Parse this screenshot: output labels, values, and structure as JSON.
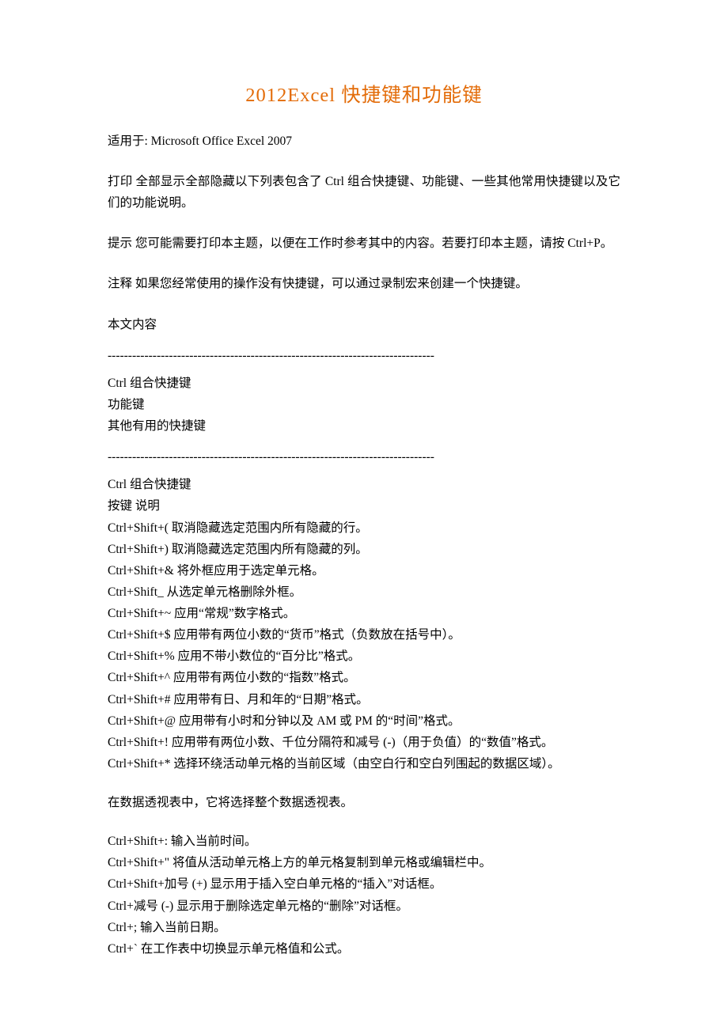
{
  "title": "2012Excel 快捷键和功能键",
  "applies_to": "适用于: Microsoft Office Excel 2007",
  "intro": "打印 全部显示全部隐藏以下列表包含了 Ctrl 组合快捷键、功能键、一些其他常用快捷键以及它们的功能说明。",
  "tip_label": "  提示",
  "tip_body": "    您可能需要打印本主题，以便在工作时参考其中的内容。若要打印本主题，请按 Ctrl+P。",
  "note_label": "  注释",
  "note_body": "    如果您经常使用的操作没有快捷键，可以通过录制宏来创建一个快捷键。",
  "toc_heading": "本文内容",
  "divider": "--------------------------------------------------------------------------------",
  "toc": {
    "item1": "Ctrl 组合快捷键",
    "item2": "功能键",
    "item3": "其他有用的快捷键"
  },
  "section1_heading": "Ctrl 组合快捷键",
  "section1_header_row": "按键 说明",
  "shortcuts1": {
    "l0": "Ctrl+Shift+( 取消隐藏选定范围内所有隐藏的行。",
    "l1": "Ctrl+Shift+) 取消隐藏选定范围内所有隐藏的列。",
    "l2": "Ctrl+Shift+& 将外框应用于选定单元格。",
    "l3": "Ctrl+Shift_ 从选定单元格删除外框。",
    "l4": "Ctrl+Shift+~ 应用“常规”数字格式。",
    "l5": "Ctrl+Shift+$ 应用带有两位小数的“货币”格式（负数放在括号中）。",
    "l6": "Ctrl+Shift+% 应用不带小数位的“百分比”格式。",
    "l7": "Ctrl+Shift+^ 应用带有两位小数的“指数”格式。",
    "l8": "Ctrl+Shift+# 应用带有日、月和年的“日期”格式。",
    "l9": "Ctrl+Shift+@ 应用带有小时和分钟以及 AM 或 PM 的“时间”格式。",
    "l10": "Ctrl+Shift+! 应用带有两位小数、千位分隔符和减号 (-)（用于负值）的“数值”格式。",
    "l11": "Ctrl+Shift+* 选择环绕活动单元格的当前区域（由空白行和空白列围起的数据区域）。"
  },
  "pivot_note": "在数据透视表中，它将选择整个数据透视表。",
  "shortcuts2": {
    "l0": "Ctrl+Shift+: 输入当前时间。",
    "l1": "Ctrl+Shift+\" 将值从活动单元格上方的单元格复制到单元格或编辑栏中。",
    "l2": "Ctrl+Shift+加号 (+) 显示用于插入空白单元格的“插入”对话框。",
    "l3": "Ctrl+减号 (-) 显示用于删除选定单元格的“删除”对话框。",
    "l4": "Ctrl+; 输入当前日期。",
    "l5": "Ctrl+` 在工作表中切换显示单元格值和公式。"
  }
}
